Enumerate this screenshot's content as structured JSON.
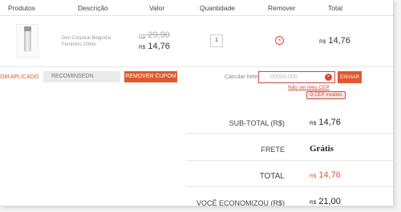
{
  "headers": {
    "produtos": "Produtos",
    "descricao": "Descrição",
    "valor": "Valor",
    "quantidade": "Quantidade",
    "remover": "Remover",
    "total": "Total"
  },
  "item": {
    "description": "Deo Corporal Biografia Feminino 100ml",
    "currency": "R$",
    "old_price": "29,90",
    "price": "14,76",
    "quantity": "1",
    "remove_icon": "x-circle-icon",
    "total": "14,76"
  },
  "coupon": {
    "label": "OM APLICADO",
    "value": "RECOMINSEDN",
    "button": "REMOVER CUPOM"
  },
  "shipping": {
    "label": "Calcular frete",
    "placeholder": "00000-000",
    "button": "ENVIAR",
    "help_link": "Não sei meu CEP",
    "error": "O CEP inválido"
  },
  "summary": {
    "subtotal_label": "SUB-TOTAL (R$)",
    "subtotal_currency": "R$",
    "subtotal_value": "14,76",
    "frete_label": "FRETE",
    "frete_value": "Grátis",
    "total_label": "TOTAL",
    "total_currency": "R$",
    "total_value": "14,76",
    "economia_label": "VOCÊ ECONOMIZOU (R$)",
    "economia_currency": "R$",
    "economia_value": "21,00"
  },
  "colors": {
    "accent": "#e2572c",
    "error": "#d04a3c"
  }
}
